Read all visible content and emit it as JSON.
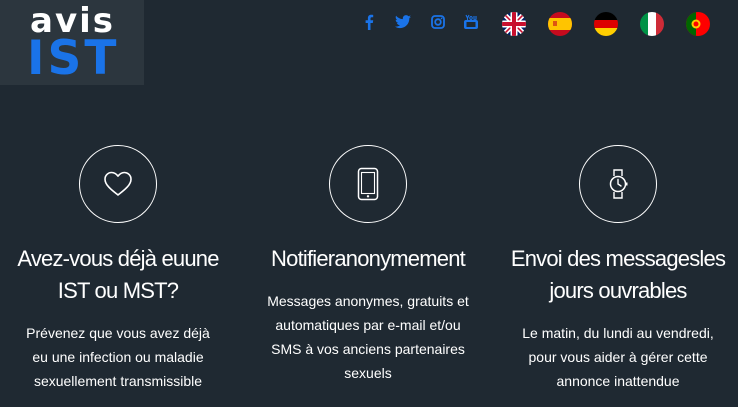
{
  "theme": {
    "background": "#1f2932",
    "accent": "#1a73e8"
  },
  "logo": {
    "line1": "avis",
    "line2": "IST"
  },
  "social": [
    "facebook-icon",
    "twitter-icon",
    "instagram-icon",
    "youtube-icon"
  ],
  "languages": [
    "english-flag-icon",
    "spanish-flag-icon",
    "german-flag-icon",
    "italian-flag-icon",
    "portuguese-flag-icon"
  ],
  "features": [
    {
      "icon": "heart-icon",
      "title": "Avez-vous déjà euune IST ou MST?",
      "description": "Prévenez que vous avez déjà eu une infection ou maladie sexuellement transmissible"
    },
    {
      "icon": "smartphone-icon",
      "title": "Notifieranonymement",
      "description": "Messages anonymes, gratuits et automatiques par e-mail et/ou SMS à vos anciens partenaires sexuels"
    },
    {
      "icon": "watch-icon",
      "title": "Envoi des messagesles jours ouvrables",
      "description": "Le matin, du lundi au vendredi, pour vous aider à gérer cette annonce inattendue"
    }
  ]
}
